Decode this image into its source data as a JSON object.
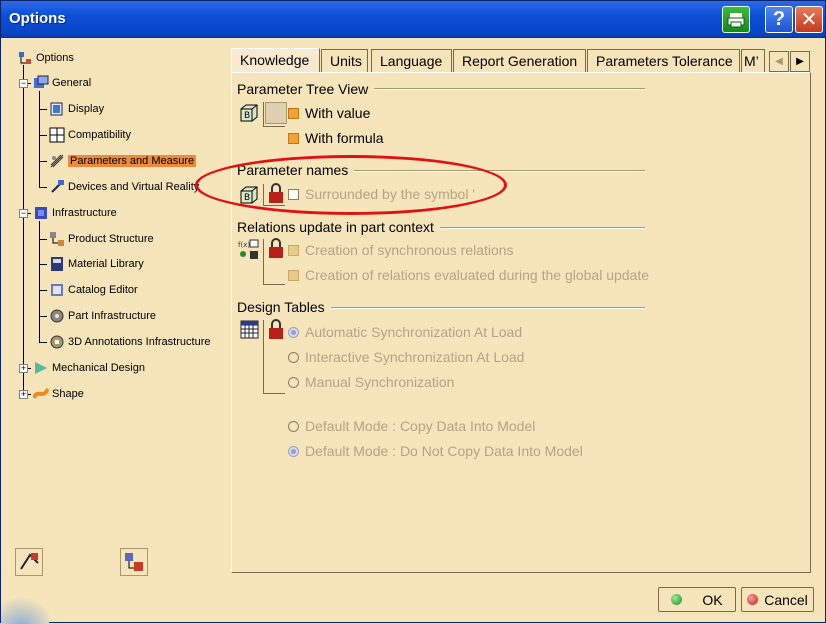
{
  "window": {
    "title": "Options"
  },
  "tree": {
    "root": "Options",
    "items": [
      {
        "label": "General",
        "icon": "general-icon"
      },
      {
        "label": "Display",
        "icon": "display-icon"
      },
      {
        "label": "Compatibility",
        "icon": "compatibility-icon"
      },
      {
        "label": "Parameters and Measure",
        "icon": "parameters-icon",
        "selected": true
      },
      {
        "label": "Devices and Virtual Reality",
        "icon": "devices-icon"
      },
      {
        "label": "Infrastructure",
        "icon": "infrastructure-icon"
      },
      {
        "label": "Product Structure",
        "icon": "product-structure-icon"
      },
      {
        "label": "Material Library",
        "icon": "material-library-icon"
      },
      {
        "label": "Catalog Editor",
        "icon": "catalog-editor-icon"
      },
      {
        "label": "Part Infrastructure",
        "icon": "part-infrastructure-icon"
      },
      {
        "label": "3D Annotations Infrastructure",
        "icon": "annotations-icon"
      },
      {
        "label": "Mechanical Design",
        "icon": "mechanical-design-icon"
      },
      {
        "label": "Shape",
        "icon": "shape-icon"
      }
    ]
  },
  "tabs": [
    "Knowledge",
    "Units",
    "Language",
    "Report Generation",
    "Parameters Tolerance",
    "M’"
  ],
  "sections": {
    "tree_view": {
      "title": "Parameter Tree View",
      "with_value": "With value",
      "with_formula": "With formula"
    },
    "param_names": {
      "title": "Parameter names",
      "surrounded": "Surrounded by the symbol '"
    },
    "relations": {
      "title": "Relations update in part context",
      "sync": "Creation of synchronous relations",
      "global": "Creation of relations evaluated during the global update"
    },
    "design_tables": {
      "title": "Design Tables",
      "auto": "Automatic Synchronization At Load",
      "interactive": "Interactive Synchronization At Load",
      "manual": "Manual Synchronization",
      "copy": "Default Mode : Copy Data Into Model",
      "nocopy": "Default Mode : Do Not Copy Data Into Model"
    }
  },
  "buttons": {
    "ok": "OK",
    "cancel": "Cancel"
  },
  "colors": {
    "titlebar": "#0b4fd7",
    "background": "#f6e4bb",
    "selection": "#ee8a3a",
    "highlight": "#e31212"
  }
}
